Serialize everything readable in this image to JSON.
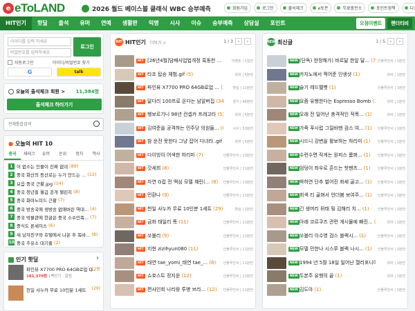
{
  "header": {
    "logo_icon": "e",
    "logo_text": "eToLAND",
    "announcement": "2026 월드 베이스볼 클래식 WBC 승부예측",
    "links": [
      "회원가입",
      "로그인",
      "출석체크",
      "e토존",
      "무료충전소",
      "포인트정책",
      "다크모드"
    ]
  },
  "nav": {
    "items": [
      "HIT인기",
      "핫딜",
      "출석",
      "유머",
      "연예",
      "생활판",
      "익명",
      "시사",
      "이슈",
      "승부예측",
      "상담실",
      "포인트"
    ],
    "active": "HIT인기",
    "right": [
      "오점이벤트",
      "랜더티비"
    ]
  },
  "login": {
    "id_placeholder": "아이디를 입력 하세요",
    "pw_placeholder": "비밀번호를 입력하세요",
    "login_button": "로그인",
    "keep_login": "자동로그인",
    "find_account": "아이디/비밀번호 찾기",
    "sns": [
      "G",
      "talk"
    ]
  },
  "attendance": {
    "label": "오늘의 출석체크 회원 >",
    "count": "11,384명",
    "button": "출석체크 하러가기"
  },
  "search": {
    "placeholder": "전체통합검색"
  },
  "hit10": {
    "title": "오늘의 HIT 10",
    "tabs": [
      "종국",
      "재테크",
      "유머",
      "순위",
      "정치",
      "역사"
    ],
    "items": [
      {
        "rank": "1",
        "title": "이 없소는 인물이 진짜 없네",
        "comments": "(89)"
      },
      {
        "rank": "2",
        "title": "중국 화산의 등산로는 누가 만드는 ...",
        "comments": "(12)"
      },
      {
        "rank": "3",
        "title": "요음 중국 근황.jpg",
        "comments": "(14)"
      },
      {
        "rank": "4",
        "title": "중국 청년들 월급 공개 챌린지",
        "comments": "(8)"
      },
      {
        "rank": "5",
        "title": "중국 화마노미드 근황",
        "comments": "(7)"
      },
      {
        "rank": "6",
        "title": "중국 방송국에 생방송 없애버린 역대...",
        "comments": "(4)"
      },
      {
        "rank": "7",
        "title": "중국 박물관에 한글은 중국 소수민족...",
        "comments": "(7)"
      },
      {
        "rank": "8",
        "title": "중식도 론세이스",
        "comments": "(6)"
      },
      {
        "rank": "9",
        "title": "새 남자친구와 호텔에서 나온 후 독바...",
        "comments": "(8)"
      },
      {
        "rank": "10",
        "title": "중국 주유소 대기줄",
        "comments": "(2)"
      }
    ]
  },
  "popular_hot": {
    "title": "인기 핫딜",
    "items": [
      {
        "title": "파인뷰 X7700 PRO 64GB로업 Q...",
        "price": "181,370원",
        "meta": "1백인기 · 알림",
        "comments": "11원"
      },
      {
        "title": "천일 사누카 무료 10인분 1세트",
        "price": "",
        "meta": "",
        "comments": "(29)"
      }
    ]
  },
  "hit_col": {
    "title": "HIT인기",
    "more": "더보기 >",
    "page": "1 / 3",
    "items": [
      {
        "tag": "HIT",
        "title": "[26년4월]담배사업법개정 흑동천 ...",
        "comments": "(3651)",
        "meta": "이벤트 | 1일전"
      },
      {
        "tag": "HIT",
        "title": "타조 탑승 체험.gif",
        "comments": "(5)",
        "meta": "유머 | 5분전"
      },
      {
        "tag": "HIT",
        "title": "파인뷰 X7700 PRO 64GB로업 ...",
        "comments": "(32)",
        "meta": "핫딜 | 11분전"
      },
      {
        "tag": "HIT",
        "title": "달다리 100프로 온다는 남알버집",
        "comments": "(34)",
        "meta": "경기 | 46분전"
      },
      {
        "tag": "HIT",
        "title": "행보르기니 98년 컨셉카 프레고타",
        "comments": "(5)",
        "meta": "유머 | 5분전"
      },
      {
        "tag": "HIT",
        "title": "김여준을 공격하는 민주당 의원들...",
        "comments": "(80)",
        "meta": "시사 | 53분전"
      },
      {
        "tag": "HIT",
        "title": "참 운전 못한다 그냥 잡어 다녀라..gif",
        "comments": "(9)",
        "meta": "유머 | 5분전"
      },
      {
        "tag": "HIT",
        "title": "다이빙이 어색한 하리미",
        "comments": "(7)",
        "meta": "인플루언서 | 13분전"
      },
      {
        "tag": "HIT",
        "title": "갓세희",
        "comments": "(8)",
        "meta": "인플루언서 | 11분전"
      },
      {
        "tag": "HIT",
        "title": "자연 G컵 전 맥심 모델 혜린(...",
        "comments": "(8)",
        "meta": "인플루언서 | 13분전"
      },
      {
        "tag": "HIT",
        "title": "민환나",
        "comments": "(9)",
        "meta": "인플루언서 | 11분전"
      },
      {
        "tag": "HIT",
        "title": "천일 사누카 무료 10인분 1세트",
        "comments": "(29)",
        "meta": "핫딜 | 1분전"
      },
      {
        "tag": "HIT",
        "title": "금화 태일리 폭",
        "comments": "(11)",
        "meta": "인플루언서 | 11분전"
      },
      {
        "tag": "HIT",
        "title": "쏘블리",
        "comments": "(9)",
        "meta": "인플루언서 | 11분전"
      },
      {
        "tag": "HIT",
        "title": "지현 zizihyun080",
        "comments": "(11)",
        "meta": "인플루언서 | 11분전"
      },
      {
        "tag": "HIT",
        "title": "태연 tae_yomi_태연 tae_...",
        "comments": "(8)",
        "meta": "인플루언서 | 11분전"
      },
      {
        "tag": "HIT",
        "title": "쇼호스트 정지윤",
        "comments": "(12)",
        "meta": "인플루언서 | 11분전"
      },
      {
        "tag": "HIT",
        "title": "편사인회 나리랑 투병 브라...",
        "comments": "(12)",
        "meta": "인플루언서 | 11분전"
      }
    ]
  },
  "new_col": {
    "title": "최신글",
    "page": "1 / 5",
    "items": [
      {
        "tag": "NEW",
        "title": "(단독) 한정해가) 바르달 한잎 달...",
        "comments": "(7)",
        "meta": "인플루언서 | 1분전"
      },
      {
        "tag": "NEW",
        "title": "카지노에서 찍어준 인생샷",
        "comments": "(1)",
        "meta": "유머 | 1분전"
      },
      {
        "tag": "NEW",
        "title": "슬기 레드벨벳",
        "comments": "(1)",
        "meta": "인플루언서 | 1분전"
      },
      {
        "tag": "NEW",
        "title": "요즘 유행한다는 Espresso Bomb",
        "comments": "(1)",
        "meta": "유머 | 1분전"
      },
      {
        "tag": "NEW",
        "title": "오래 전 일어난 충격적인 적폭...",
        "comments": "(1)",
        "meta": "유머 | 1분전"
      },
      {
        "tag": "NEW",
        "title": "가죽 푸시럽 그릴바맨 검스 여...",
        "comments": "(1)",
        "meta": "인플루언서 | 1분전"
      },
      {
        "tag": "NEW",
        "title": "시드니 강변을 활보하는 하리미",
        "comments": "(1)",
        "meta": "인플루언서 | 1분전"
      },
      {
        "tag": "NEW",
        "title": "수련수면 작게는 원피스 룸펴...",
        "comments": "(1)",
        "meta": "인플루언서 | 1분전"
      },
      {
        "tag": "NEW",
        "title": "엄덩이 좌우로 흔드는 핫팬츠...",
        "comments": "(1)",
        "meta": "인플루언서 | 1분전"
      },
      {
        "tag": "NEW",
        "title": "박하연 단추 벌어진 화세 골고...",
        "comments": "(1)",
        "meta": "인플루언서 | 1분전"
      },
      {
        "tag": "NEW",
        "title": "회색 티 골펴서 언더붐 보여주...",
        "comments": "(1)",
        "meta": "인플루언서 | 1분전"
      },
      {
        "tag": "NEW",
        "title": "긴 생머리 뒤태 및 김해리 치...",
        "comments": "(1)",
        "meta": "인플루언서 | 1분전"
      },
      {
        "tag": "NEW",
        "title": "아래 코르쿠즈 관련 게시물에 빠진...",
        "comments": "(1)",
        "meta": "유머 | 1분전"
      },
      {
        "tag": "NEW",
        "title": "쏘블리 이수영 검스 블랙시...",
        "comments": "(1)",
        "meta": "인플루언서 | 1분전"
      },
      {
        "tag": "NEW",
        "title": "모델 민한나 시스루 블랙 나시...",
        "comments": "(1)",
        "meta": "인플루언서 | 1분전"
      },
      {
        "tag": "NEW",
        "title": "1994 년 5월 18일 일어난 캘리포니아...",
        "comments": "(1)",
        "meta": "유머 | 1분전"
      },
      {
        "tag": "NEW",
        "title": "두본주 유행의 끝",
        "comments": "(1)",
        "meta": "유머 | 1분전"
      },
      {
        "tag": "NEW",
        "title": "김도아",
        "comments": "(1)",
        "meta": "인플루언서 | 1분전"
      }
    ]
  },
  "colors": {
    "brand_green": "#2f9e44",
    "hit_orange": "#ff5a1f",
    "comment_orange": "#e07b00"
  }
}
